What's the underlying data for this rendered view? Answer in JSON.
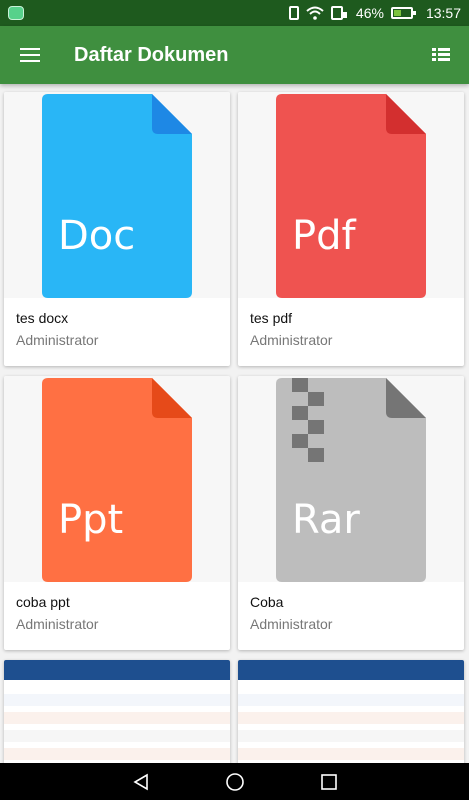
{
  "status_bar": {
    "battery_percent": "46%",
    "battery_level": 0.46,
    "time": "13:57"
  },
  "app_bar": {
    "title": "Daftar Dokumen",
    "menu_icon": "hamburger-menu-icon",
    "view_icon": "list-view-icon"
  },
  "documents": [
    {
      "name": "tes docx",
      "owner": "Administrator",
      "type_label": "Doc",
      "color": "#29b6f6",
      "fold_color": "#1e88e5"
    },
    {
      "name": "tes pdf",
      "owner": "Administrator",
      "type_label": "Pdf",
      "color": "#ef5350",
      "fold_color": "#d32f2f"
    },
    {
      "name": "coba ppt",
      "owner": "Administrator",
      "type_label": "Ppt",
      "color": "#ff7043",
      "fold_color": "#e64a19"
    },
    {
      "name": "Coba",
      "owner": "Administrator",
      "type_label": "Rar",
      "color": "#bdbdbd",
      "fold_color": "#757575"
    }
  ],
  "partial_cards": [
    {
      "header_color": "#1e4f8f"
    },
    {
      "header_color": "#1e4f8f"
    }
  ],
  "nav_bar": {
    "back_icon": "back-triangle-icon",
    "home_icon": "home-circle-icon",
    "recents_icon": "recents-square-icon"
  }
}
